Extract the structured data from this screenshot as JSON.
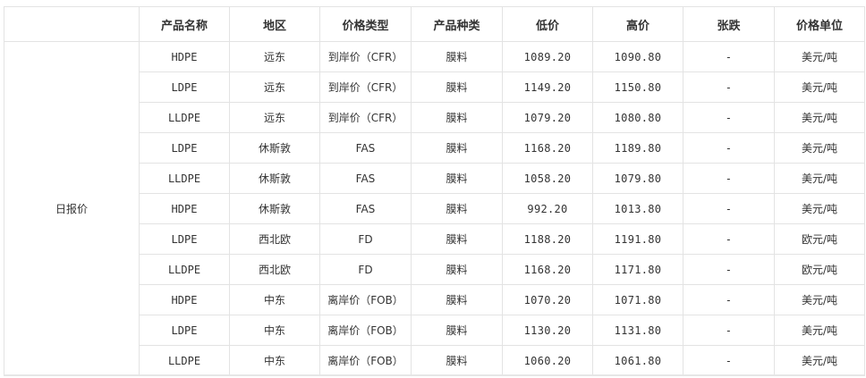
{
  "table": {
    "headers": [
      "",
      "产品名称",
      "地区",
      "价格类型",
      "产品种类",
      "低价",
      "高价",
      "张跌",
      "价格单位"
    ],
    "group_label": "日报价",
    "rows": [
      {
        "product": "HDPE",
        "region": "远东",
        "price_type": "到岸价（CFR）",
        "category": "膜料",
        "low": "1089.20",
        "high": "1090.80",
        "change": "-",
        "unit": "美元/吨"
      },
      {
        "product": "LDPE",
        "region": "远东",
        "price_type": "到岸价（CFR）",
        "category": "膜料",
        "low": "1149.20",
        "high": "1150.80",
        "change": "-",
        "unit": "美元/吨"
      },
      {
        "product": "LLDPE",
        "region": "远东",
        "price_type": "到岸价（CFR）",
        "category": "膜料",
        "low": "1079.20",
        "high": "1080.80",
        "change": "-",
        "unit": "美元/吨"
      },
      {
        "product": "LDPE",
        "region": "休斯敦",
        "price_type": "FAS",
        "category": "膜料",
        "low": "1168.20",
        "high": "1189.80",
        "change": "-",
        "unit": "美元/吨"
      },
      {
        "product": "LLDPE",
        "region": "休斯敦",
        "price_type": "FAS",
        "category": "膜料",
        "low": "1058.20",
        "high": "1079.80",
        "change": "-",
        "unit": "美元/吨"
      },
      {
        "product": "HDPE",
        "region": "休斯敦",
        "price_type": "FAS",
        "category": "膜料",
        "low": "992.20",
        "high": "1013.80",
        "change": "-",
        "unit": "美元/吨"
      },
      {
        "product": "LDPE",
        "region": "西北欧",
        "price_type": "FD",
        "category": "膜料",
        "low": "1188.20",
        "high": "1191.80",
        "change": "-",
        "unit": "欧元/吨"
      },
      {
        "product": "LLDPE",
        "region": "西北欧",
        "price_type": "FD",
        "category": "膜料",
        "low": "1168.20",
        "high": "1171.80",
        "change": "-",
        "unit": "欧元/吨"
      },
      {
        "product": "HDPE",
        "region": "中东",
        "price_type": "离岸价（FOB）",
        "category": "膜料",
        "low": "1070.20",
        "high": "1071.80",
        "change": "-",
        "unit": "美元/吨"
      },
      {
        "product": "LDPE",
        "region": "中东",
        "price_type": "离岸价（FOB）",
        "category": "膜料",
        "low": "1130.20",
        "high": "1131.80",
        "change": "-",
        "unit": "美元/吨"
      },
      {
        "product": "LLDPE",
        "region": "中东",
        "price_type": "离岸价（FOB）",
        "category": "膜料",
        "low": "1060.20",
        "high": "1061.80",
        "change": "-",
        "unit": "美元/吨"
      }
    ]
  }
}
